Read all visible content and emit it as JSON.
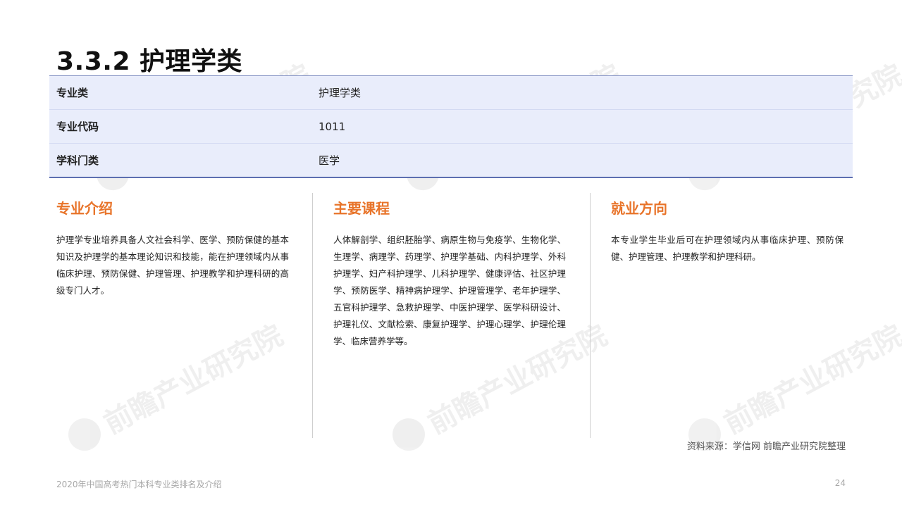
{
  "page_title": "3.3.2 护理学类",
  "info_table": [
    {
      "label": "专业类",
      "value": "护理学类"
    },
    {
      "label": "专业代码",
      "value": "1011"
    },
    {
      "label": "学科门类",
      "value": "医学"
    }
  ],
  "sections": [
    {
      "heading": "专业介绍",
      "body": "护理学专业培养具备人文社会科学、医学、预防保健的基本知识及护理学的基本理论知识和技能，能在护理领域内从事临床护理、预防保健、护理管理、护理教学和护理科研的高级专门人才。"
    },
    {
      "heading": "主要课程",
      "body": "人体解剖学、组织胚胎学、病原生物与免疫学、生物化学、生理学、病理学、药理学、护理学基础、内科护理学、外科护理学、妇产科护理学、儿科护理学、健康评估、社区护理学、预防医学、精神病护理学、护理管理学、老年护理学、五官科护理学、急救护理学、中医护理学、医学科研设计、护理礼仪、文献检索、康复护理学、护理心理学、护理伦理学、临床营养学等。"
    },
    {
      "heading": "就业方向",
      "body": "本专业学生毕业后可在护理领域内从事临床护理、预防保健、护理管理、护理教学和护理科研。"
    }
  ],
  "source": "资料来源：学信网 前瞻产业研究院整理",
  "footer": {
    "doc_title": "2020年中国高考热门本科专业类排名及介绍",
    "page_number": "24"
  },
  "watermark_text": "前瞻产业研究院",
  "colors": {
    "accent": "#e8742a",
    "table_bg": "#e9edfb",
    "table_border": "#5d6fb0"
  }
}
